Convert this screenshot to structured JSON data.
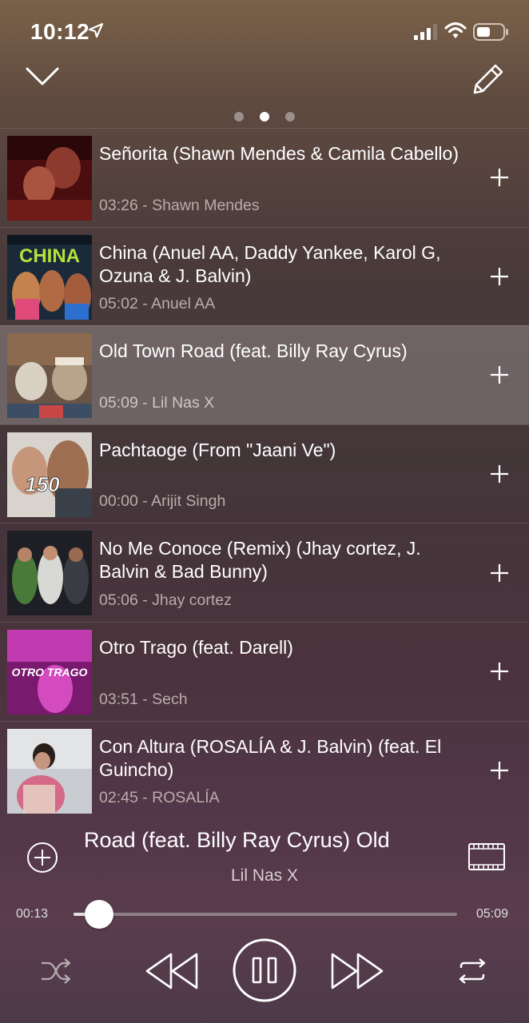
{
  "status_bar": {
    "time": "10:12"
  },
  "pager": {
    "count": 3,
    "active": 1
  },
  "songs": [
    {
      "title": "Señorita (Shawn Mendes & Camila Cabello)",
      "duration": "03:26",
      "artist": "Shawn Mendes",
      "active": false
    },
    {
      "title": "China (Anuel AA, Daddy Yankee, Karol G, Ozuna & J. Balvin)",
      "duration": "05:02",
      "artist": "Anuel AA",
      "active": false,
      "thumb_text": "CHINA"
    },
    {
      "title": "Old Town Road (feat. Billy Ray Cyrus)",
      "duration": "05:09",
      "artist": "Lil Nas X",
      "active": true
    },
    {
      "title": "Pachtaoge (From \"Jaani Ve\")",
      "duration": "00:00",
      "artist": "Arijit Singh",
      "active": false,
      "thumb_text": "150"
    },
    {
      "title": "No Me Conoce (Remix) (Jhay cortez, J. Balvin & Bad Bunny)",
      "duration": "05:06",
      "artist": "Jhay cortez",
      "active": false
    },
    {
      "title": "Otro Trago (feat. Darell)",
      "duration": "03:51",
      "artist": "Sech",
      "active": false,
      "thumb_text": "OTRO TRAGO"
    },
    {
      "title": "Con Altura (ROSALÍA & J. Balvin) (feat. El Guincho)",
      "duration": "02:45",
      "artist": "ROSALÍA",
      "active": false
    }
  ],
  "now_playing": {
    "title": "Old Town Road (feat. Billy Ray Cyrus)",
    "title_marquee": "own Road (feat. Billy Ray Cyrus)   Old",
    "artist": "Lil Nas X",
    "elapsed": "00:13",
    "total": "05:09",
    "progress": 0.066
  },
  "colors": {
    "accent": "#ffffff",
    "meta_text": "#b9adab",
    "active_row": "rgba(255,255,255,0.22)"
  },
  "icons": [
    "location-arrow-icon",
    "signal-icon",
    "wifi-icon",
    "battery-icon",
    "chevron-down-icon",
    "pencil-icon",
    "plus-icon",
    "add-circle-icon",
    "video-icon",
    "shuffle-icon",
    "rewind-icon",
    "pause-icon",
    "fast-forward-icon",
    "repeat-icon"
  ]
}
